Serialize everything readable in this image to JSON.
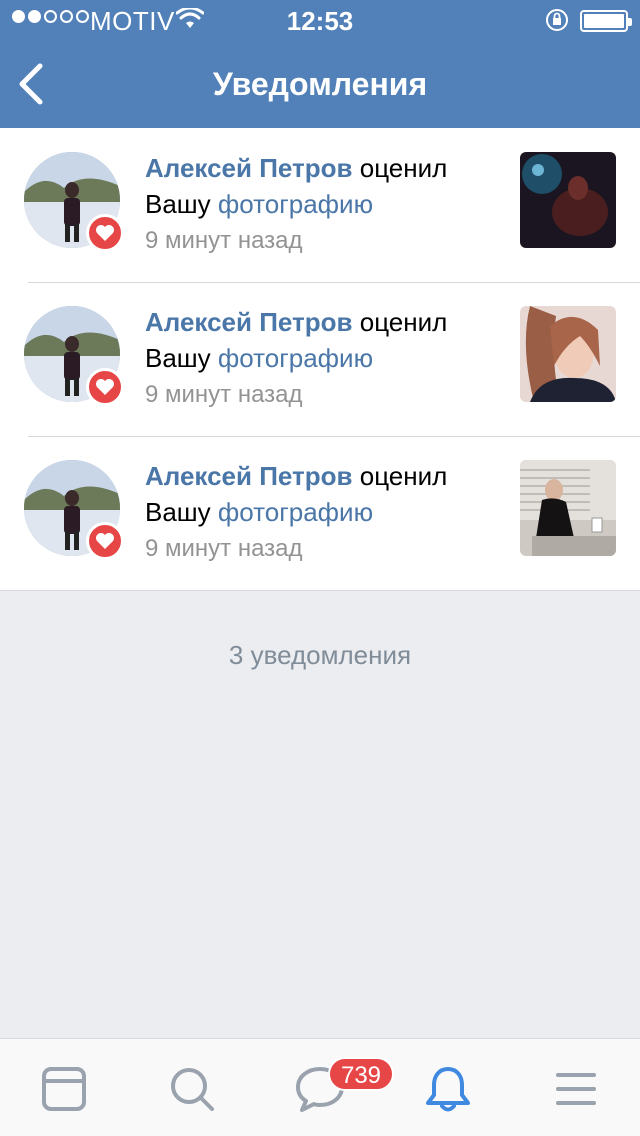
{
  "status_bar": {
    "carrier": "MOTIV",
    "time": "12:53",
    "signal_dots_filled": 2,
    "signal_dots_total": 5
  },
  "header": {
    "title": "Уведомления",
    "back_icon": "chevron-left-icon"
  },
  "notifications": [
    {
      "user": "Алексей Петров",
      "action": "оценил",
      "text_before_link": "Вашу",
      "link": "фотографию",
      "time": "9 минут назад",
      "badge_icon": "heart-icon"
    },
    {
      "user": "Алексей Петров",
      "action": "оценил",
      "text_before_link": "Вашу",
      "link": "фотографию",
      "time": "9 минут назад",
      "badge_icon": "heart-icon"
    },
    {
      "user": "Алексей Петров",
      "action": "оценил",
      "text_before_link": "Вашу",
      "link": "фотографию",
      "time": "9 минут назад",
      "badge_icon": "heart-icon"
    }
  ],
  "summary": "3 уведомления",
  "tabbar": {
    "tabs": [
      "news-icon",
      "search-icon",
      "messages-icon",
      "notifications-icon",
      "menu-icon"
    ],
    "active": "notifications-icon",
    "messages_badge": "739"
  },
  "colors": {
    "header_bg": "#5181b8",
    "link": "#4a76a8",
    "badge": "#e64646",
    "active_tab": "#3f8ae0"
  }
}
